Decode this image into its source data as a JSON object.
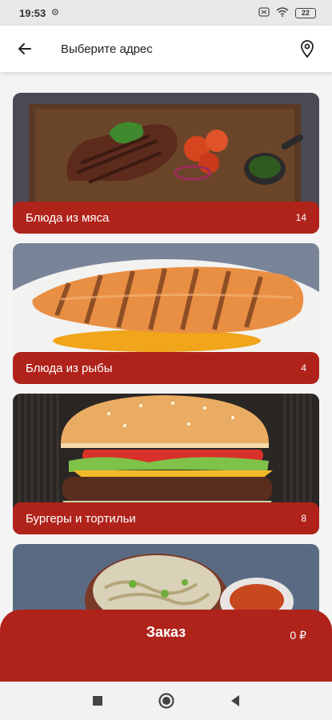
{
  "status": {
    "time": "19:53",
    "battery": "22"
  },
  "header": {
    "title": "Выберите адрес"
  },
  "categories": [
    {
      "name": "Блюда из мяса",
      "count": "14"
    },
    {
      "name": "Блюда из рыбы",
      "count": "4"
    },
    {
      "name": "Бургеры и тортильи",
      "count": "8"
    },
    {
      "name": "",
      "count": ""
    }
  ],
  "order": {
    "label": "Заказ",
    "sum": "0 ₽"
  },
  "colors": {
    "accent": "#b0231b"
  }
}
